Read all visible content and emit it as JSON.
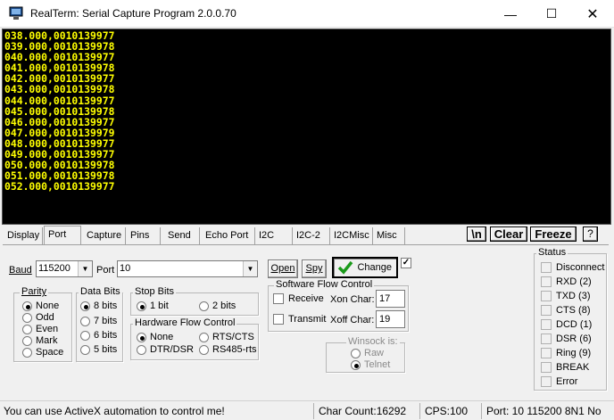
{
  "window": {
    "title": "RealTerm: Serial Capture Program 2.0.0.70",
    "minimize_glyph": "—",
    "maximize_glyph": "☐",
    "close_glyph": "✕"
  },
  "terminal": {
    "lines": [
      "038.000,0010139977",
      "039.000,0010139978",
      "040.000,0010139977",
      "041.000,0010139978",
      "042.000,0010139977",
      "043.000,0010139978",
      "044.000,0010139977",
      "045.000,0010139978",
      "046.000,0010139977",
      "047.000,0010139979",
      "048.000,0010139977",
      "049.000,0010139977",
      "050.000,0010139978",
      "051.000,0010139978",
      "052.000,0010139977"
    ],
    "text_color": "#ffff00"
  },
  "tabs": [
    "Display",
    "Port",
    "Capture",
    "Pins",
    "Send",
    "Echo Port",
    "I2C",
    "I2C-2",
    "I2CMisc",
    "Misc"
  ],
  "tab_active": "Port",
  "toolbar": {
    "newline": "\\n",
    "clear": "Clear",
    "freeze": "Freeze",
    "help": "?"
  },
  "port": {
    "baud_label": "Baud",
    "baud_value": "115200",
    "port_label": "Port",
    "port_value": "10",
    "open_label": "Open",
    "spy_label": "Spy",
    "change_label": "Change",
    "change_checked": "✓"
  },
  "parity": {
    "title": "Parity",
    "options": [
      "None",
      "Odd",
      "Even",
      "Mark",
      "Space"
    ],
    "selected": "None"
  },
  "data_bits": {
    "title": "Data Bits",
    "options": [
      "8 bits",
      "7 bits",
      "6 bits",
      "5 bits"
    ],
    "selected": "8 bits"
  },
  "stop_bits": {
    "title": "Stop Bits",
    "options": [
      "1 bit",
      "2 bits"
    ],
    "selected": "1 bit"
  },
  "hw_flow": {
    "title": "Hardware Flow Control",
    "options": [
      "None",
      "RTS/CTS",
      "DTR/DSR",
      "RS485-rts"
    ],
    "selected": "None"
  },
  "sw_flow": {
    "title": "Software Flow Control",
    "receive_label": "Receive",
    "transmit_label": "Transmit",
    "xon_label": "Xon Char:",
    "xon_value": "17",
    "xoff_label": "Xoff Char:",
    "xoff_value": "19"
  },
  "winsock": {
    "title": "Winsock is:",
    "options": [
      "Raw",
      "Telnet"
    ],
    "selected": "Telnet"
  },
  "status": {
    "title": "Status",
    "items": [
      "Disconnect",
      "RXD (2)",
      "TXD (3)",
      "CTS (8)",
      "DCD (1)",
      "DSR (6)",
      "Ring (9)",
      "BREAK",
      "Error"
    ]
  },
  "statusbar": {
    "message": "You can use ActiveX automation to control me!",
    "char_count": "Char Count:16292",
    "cps": "CPS:100",
    "port_info": "Port: 10 115200 8N1 No"
  }
}
